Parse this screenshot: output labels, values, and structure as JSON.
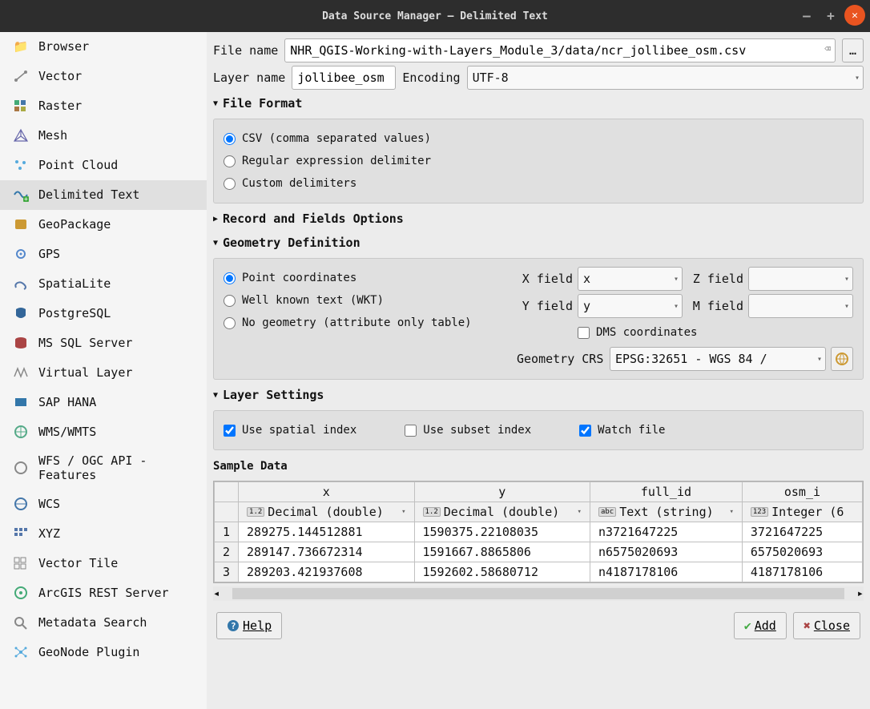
{
  "title": "Data Source Manager — Delimited Text",
  "sidebar": {
    "items": [
      {
        "label": "Browser"
      },
      {
        "label": "Vector"
      },
      {
        "label": "Raster"
      },
      {
        "label": "Mesh"
      },
      {
        "label": "Point Cloud"
      },
      {
        "label": "Delimited Text"
      },
      {
        "label": "GeoPackage"
      },
      {
        "label": "GPS"
      },
      {
        "label": "SpatiaLite"
      },
      {
        "label": "PostgreSQL"
      },
      {
        "label": "MS SQL Server"
      },
      {
        "label": "Virtual Layer"
      },
      {
        "label": "SAP HANA"
      },
      {
        "label": "WMS/WMTS"
      },
      {
        "label": "WFS / OGC API - Features"
      },
      {
        "label": "WCS"
      },
      {
        "label": "XYZ"
      },
      {
        "label": "Vector Tile"
      },
      {
        "label": "ArcGIS REST Server"
      },
      {
        "label": "Metadata Search"
      },
      {
        "label": "GeoNode Plugin"
      }
    ]
  },
  "labels": {
    "file_name": "File name",
    "layer_name": "Layer name",
    "encoding": "Encoding",
    "browse": "…",
    "file_format": "File Format",
    "record_fields": "Record and Fields Options",
    "geometry_def": "Geometry Definition",
    "layer_settings": "Layer Settings",
    "sample_data": "Sample Data",
    "x_field": "X field",
    "y_field": "Y field",
    "z_field": "Z field",
    "m_field": "M field",
    "dms": "DMS coordinates",
    "geom_crs": "Geometry CRS"
  },
  "fields": {
    "file_name": "NHR_QGIS-Working-with-Layers_Module_3/data/ncr_jollibee_osm.csv",
    "layer_name": "jollibee_osm",
    "encoding": "UTF-8",
    "x_field": "x",
    "y_field": "y",
    "z_field": "",
    "m_field": "",
    "crs": "EPSG:32651 - WGS 84 /"
  },
  "file_format": {
    "csv": "CSV (comma separated values)",
    "regex": "Regular expression delimiter",
    "custom": "Custom delimiters"
  },
  "geom": {
    "point": "Point coordinates",
    "wkt": "Well known text (WKT)",
    "none": "No geometry (attribute only table)"
  },
  "layer_opts": {
    "spatial_idx": "Use spatial index",
    "subset_idx": "Use subset index",
    "watch": "Watch file"
  },
  "table": {
    "headers": [
      "x",
      "y",
      "full_id",
      "osm_i"
    ],
    "types": [
      {
        "badge": "1.2",
        "label": "Decimal (double)"
      },
      {
        "badge": "1.2",
        "label": "Decimal (double)"
      },
      {
        "badge": "abc",
        "label": "Text (string)"
      },
      {
        "badge": "123",
        "label": "Integer (6"
      }
    ],
    "rows": [
      {
        "n": "1",
        "c": [
          "289275.144512881",
          "1590375.22108035",
          "n3721647225",
          "3721647225"
        ]
      },
      {
        "n": "2",
        "c": [
          "289147.736672314",
          "1591667.8865806",
          "n6575020693",
          "6575020693"
        ]
      },
      {
        "n": "3",
        "c": [
          "289203.421937608",
          "1592602.58680712",
          "n4187178106",
          "4187178106"
        ]
      }
    ]
  },
  "buttons": {
    "help": "Help",
    "add": "Add",
    "close": "Close"
  }
}
